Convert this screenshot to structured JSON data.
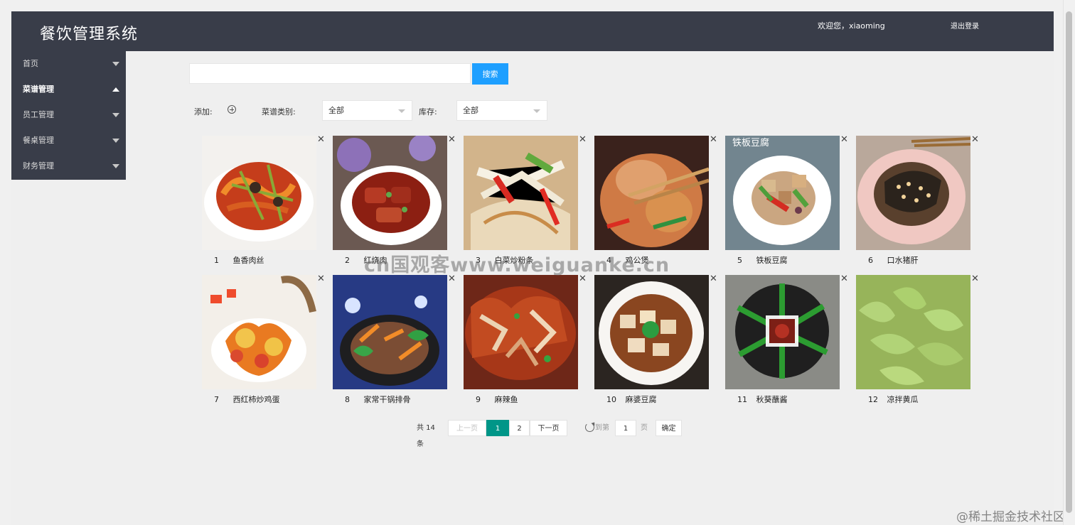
{
  "header": {
    "app_title": "餐饮管理系统",
    "welcome": "欢迎您，xiaoming",
    "logout": "退出登录"
  },
  "sidebar": {
    "items": [
      {
        "label": "首页",
        "expanded": false
      },
      {
        "label": "菜谱管理",
        "expanded": true
      },
      {
        "label": "员工管理",
        "expanded": false
      },
      {
        "label": "餐桌管理",
        "expanded": false
      },
      {
        "label": "财务管理",
        "expanded": false
      }
    ]
  },
  "search": {
    "value": "",
    "placeholder": "",
    "button_label": "搜索"
  },
  "filters": {
    "add_label": "添加:",
    "category_label": "菜谱类别:",
    "category_value": "全部",
    "stock_label": "库存:",
    "stock_value": "全部"
  },
  "dishes": [
    {
      "id": "1",
      "name": "鱼香肉丝"
    },
    {
      "id": "2",
      "name": "红烧肉"
    },
    {
      "id": "3",
      "name": "白菜炒粉条"
    },
    {
      "id": "4",
      "name": "鸡公煲"
    },
    {
      "id": "5",
      "name": "铁板豆腐"
    },
    {
      "id": "6",
      "name": "口水猪肝"
    },
    {
      "id": "7",
      "name": "西红柿炒鸡蛋"
    },
    {
      "id": "8",
      "name": "家常干锅排骨"
    },
    {
      "id": "9",
      "name": "麻辣鱼"
    },
    {
      "id": "10",
      "name": "麻婆豆腐"
    },
    {
      "id": "11",
      "name": "秋葵蘸酱"
    },
    {
      "id": "12",
      "name": "凉拌黄瓜"
    }
  ],
  "dish_image_text": {
    "dish_5_overlay": "铁板豆腐"
  },
  "pagination": {
    "total": "共 14 条",
    "prev": "上一页",
    "current": "1",
    "page2": "2",
    "next": "下一页",
    "goto_prefix": "到第",
    "goto_value": "1",
    "goto_suffix": "页",
    "confirm": "确定"
  },
  "watermarks": {
    "center": "cn国观客www.weiguanke.cn",
    "corner": "@稀土掘金技术社区"
  },
  "colors": {
    "header_bg": "#393d49",
    "sidebar_bg": "#393d49",
    "search_button": "#1e9fff",
    "pagination_current": "#009688",
    "page_bg": "#efefef"
  }
}
